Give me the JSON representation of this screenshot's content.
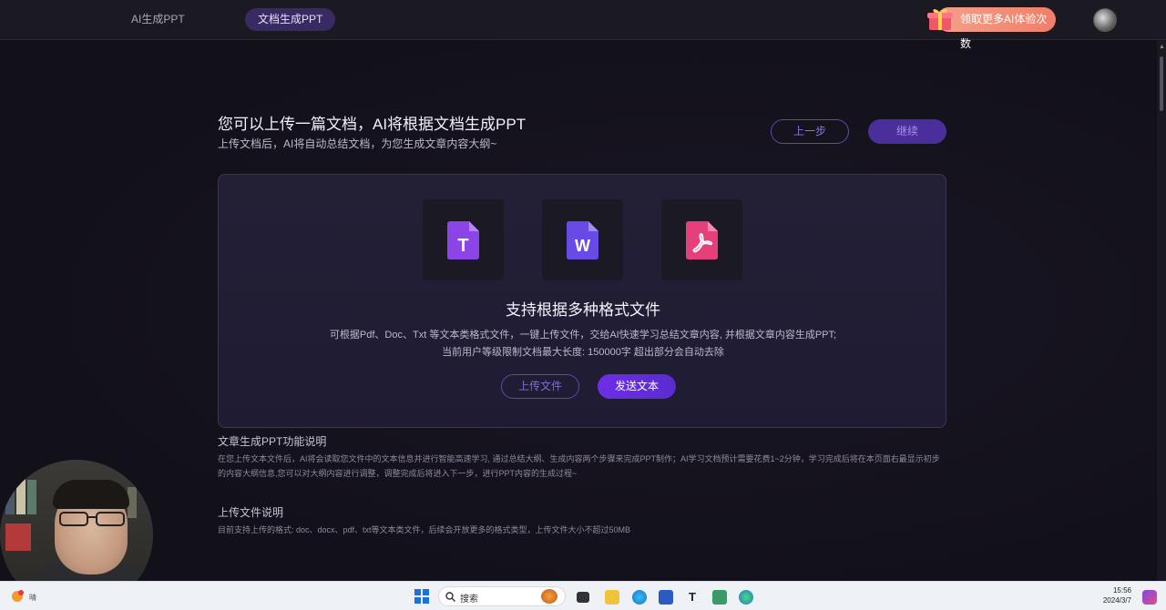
{
  "nav": {
    "tabs": [
      {
        "label": "AI生成PPT"
      },
      {
        "label": "文档生成PPT"
      }
    ],
    "promo_label": "领取更多AI体验次数"
  },
  "header": {
    "title": "您可以上传一篇文档，AI将根据文档生成PPT",
    "subtitle": "上传文档后，AI将自动总结文档，为您生成文章内容大纲~",
    "prev_label": "上一步",
    "next_label": "继续"
  },
  "card": {
    "file_icons": [
      {
        "name": "txt-file-icon",
        "letter": "T",
        "color": "#8b45e6"
      },
      {
        "name": "word-file-icon",
        "letter": "W",
        "color": "#6a4ae6"
      },
      {
        "name": "pdf-file-icon",
        "letter": "",
        "color": "#e6407a"
      }
    ],
    "title": "支持根据多种格式文件",
    "desc_line1": "可根据Pdf、Doc、Txt 等文本类格式文件，一键上传文件，交给AI快速学习总结文章内容, 并根据文章内容生成PPT;",
    "desc_line2": "当前用户等级限制文档最大长度: 150000字 超出部分会自动去除",
    "upload_label": "上传文件",
    "send_label": "发送文本"
  },
  "sections": [
    {
      "title": "文章生成PPT功能说明",
      "text": "在您上传文本文件后，AI将会读取您文件中的文本信息并进行智能高速学习, 通过总结大纲、生成内容两个步骤来完成PPT制作；AI学习文档预计需要花费1~2分钟，学习完成后将在本页面右最显示初步的内容大纲信息,您可以对大纲内容进行调整，调整完成后将进入下一步，进行PPT内容的生成过程~"
    },
    {
      "title": "上传文件说明",
      "text": "目前支持上传的格式: doc、docx、pdf、txt等文本类文件，后续会开放更多的格式类型，上传文件大小不超过50MB"
    }
  ],
  "taskbar": {
    "search_placeholder": "搜索",
    "time": "15:56",
    "date": "2024/3/7",
    "left_text": "晴"
  }
}
